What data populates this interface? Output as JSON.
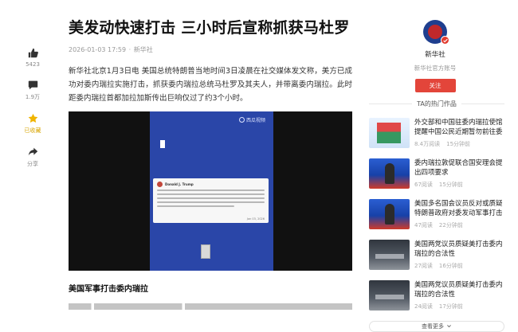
{
  "rail": {
    "like_count": "5423",
    "comment_count": "1.9万",
    "collect_label": "已收藏",
    "share_label": "分享"
  },
  "article": {
    "title": "美发动快速打击 三小时后宣称抓获马杜罗",
    "date": "2026-01-03 17:59",
    "source": "新华社",
    "lead": "新华社北京1月3日电 美国总统特朗普当地时间3日凌晨在社交媒体发文称，美方已成功对委内瑞拉实施打击，抓获委内瑞拉总统马杜罗及其夫人，并带离委内瑞拉。此时距委内瑞拉首都加拉加斯传出巨响仅过了约3个小时。",
    "media_logo": "西瓜视频",
    "card_name": "Donald J. Trump",
    "card_foot": "Jan 03, 2026",
    "subhead": "美国军事打击委内瑞拉"
  },
  "author": {
    "name": "新华社",
    "desc": "新华社官方账号",
    "follow_label": "关注"
  },
  "hot": {
    "title": "TA的热门作品",
    "items": [
      {
        "text": "外交部和中国驻委内瑞拉使馆提醒中国公民近期暂勿前往委内瑞拉",
        "reads": "8.4万阅读",
        "time": "15分钟前",
        "thumb": "thumb-0"
      },
      {
        "text": "委内瑞拉敦促联合国安理会提出四项要求",
        "reads": "67阅读",
        "time": "15分钟前",
        "thumb": "thumb-news"
      },
      {
        "text": "美国多名国会议员反对或质疑特朗普政府对委发动军事打击",
        "reads": "47阅读",
        "time": "22分钟前",
        "thumb": "thumb-news"
      },
      {
        "text": "美国两党议员质疑美打击委内瑞拉的合法性",
        "reads": "27阅读",
        "time": "16分钟前",
        "thumb": "thumb-road"
      },
      {
        "text": "美国两党议员质疑美打击委内瑞拉的合法性",
        "reads": "24阅读",
        "time": "17分钟前",
        "thumb": "thumb-road"
      }
    ],
    "more_label": "查看更多"
  }
}
